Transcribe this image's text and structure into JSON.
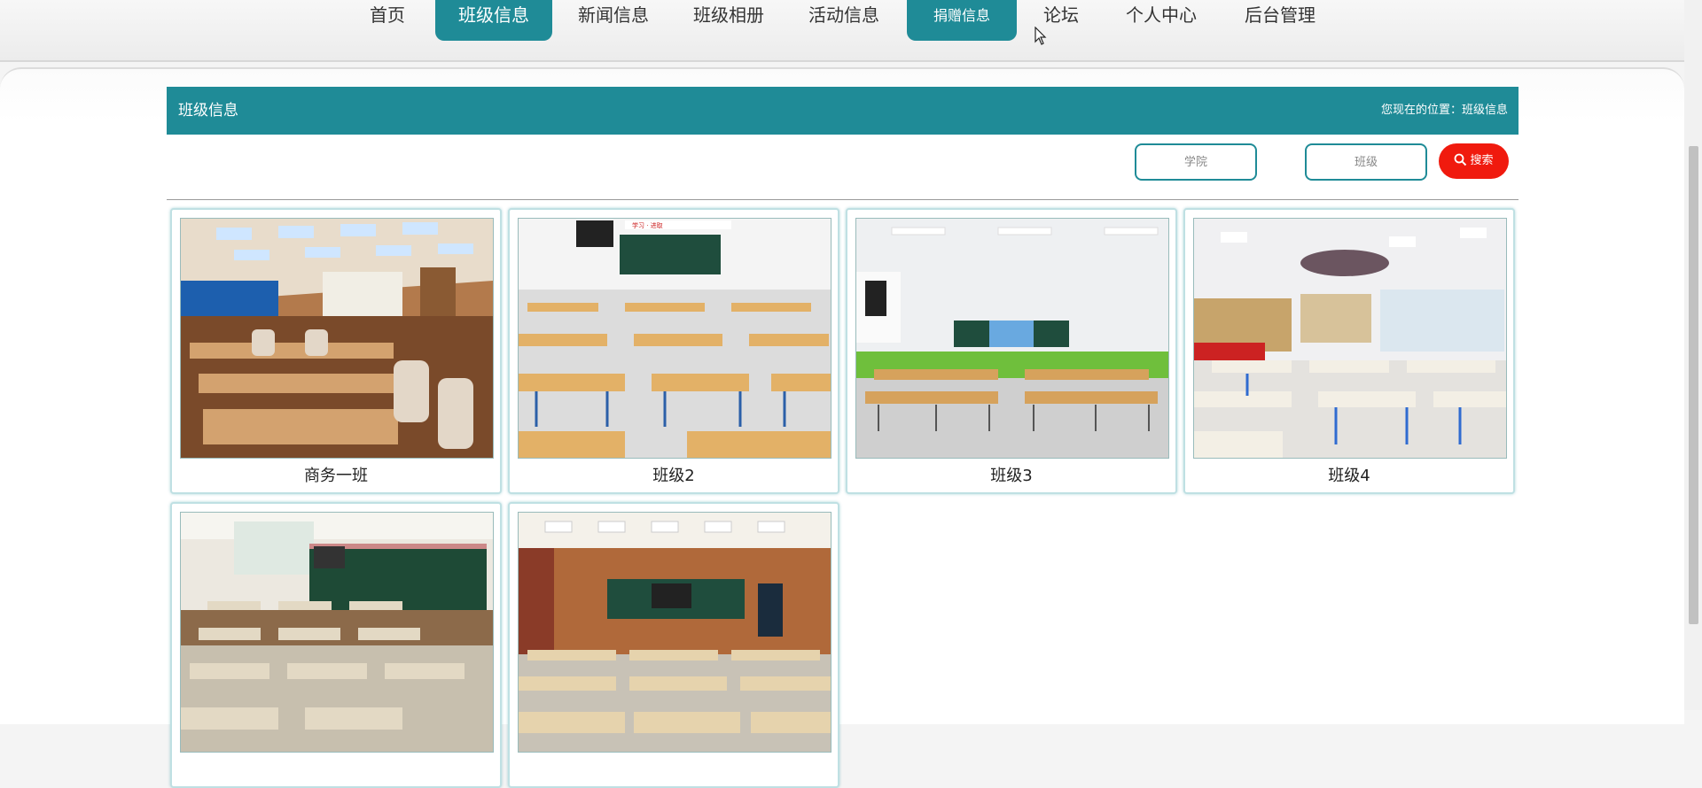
{
  "nav": {
    "items": [
      {
        "label": "首页"
      },
      {
        "label": "班级信息"
      },
      {
        "label": "新闻信息"
      },
      {
        "label": "班级相册"
      },
      {
        "label": "活动信息"
      },
      {
        "label": "捐赠信息"
      },
      {
        "label": "论坛"
      },
      {
        "label": "个人中心"
      },
      {
        "label": "后台管理"
      }
    ]
  },
  "header": {
    "title": "班级信息",
    "breadcrumb": "您现在的位置：班级信息"
  },
  "search": {
    "college_placeholder": "学院",
    "class_placeholder": "班级",
    "button_label": "搜索"
  },
  "classes": [
    {
      "name": "商务一班"
    },
    {
      "name": "班级2"
    },
    {
      "name": "班级3"
    },
    {
      "name": "班级4"
    },
    {
      "name": ""
    },
    {
      "name": ""
    }
  ],
  "colors": {
    "accent": "#1f8b97",
    "search_button": "#f01a0e"
  }
}
